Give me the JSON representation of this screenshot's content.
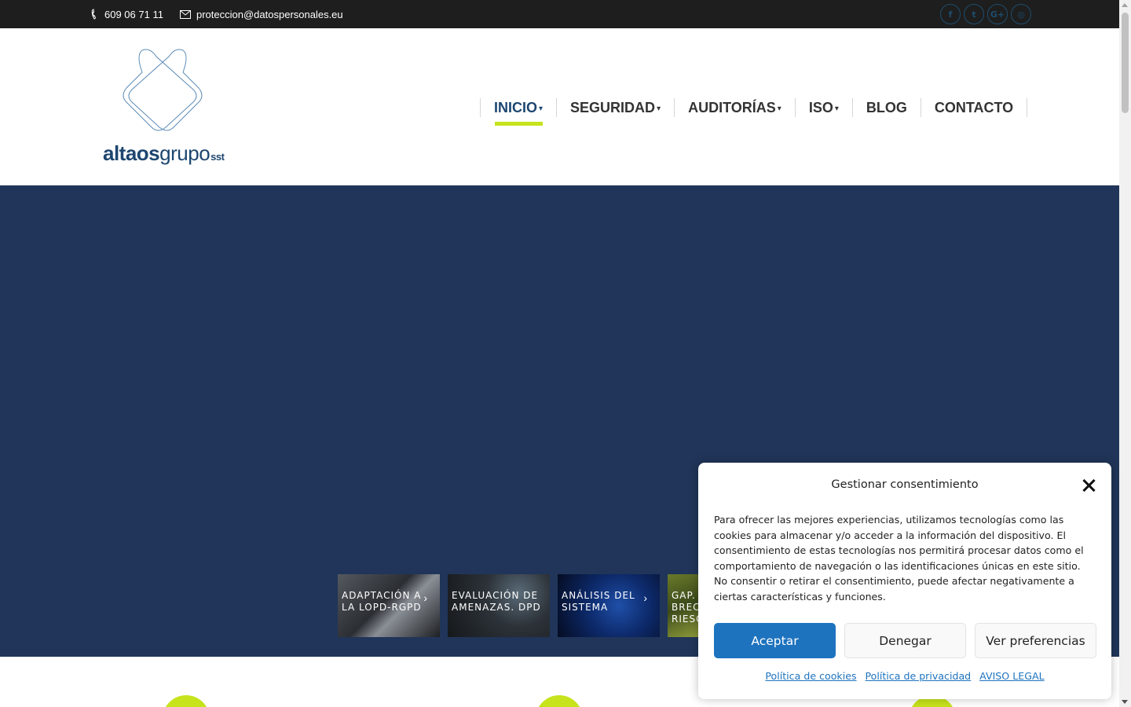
{
  "topbar": {
    "phone": "609 06 71 11",
    "email": "proteccion@datospersonales.eu",
    "socials": [
      {
        "icon": "facebook-icon",
        "glyph": "f"
      },
      {
        "icon": "twitter-icon",
        "glyph": "t"
      },
      {
        "icon": "google-plus-icon",
        "glyph": "G+"
      },
      {
        "icon": "dribbble-icon",
        "glyph": "◎"
      }
    ]
  },
  "logo": {
    "bold": "altaos",
    "regular": "grupo",
    "suffix": "sst"
  },
  "nav": {
    "items": [
      {
        "label": "INICIO",
        "dropdown": true,
        "active": true
      },
      {
        "label": "SEGURIDAD",
        "dropdown": true,
        "active": false
      },
      {
        "label": "AUDITORÍAS",
        "dropdown": true,
        "active": false
      },
      {
        "label": "ISO",
        "dropdown": true,
        "active": false
      },
      {
        "label": "BLOG",
        "dropdown": false,
        "active": false
      },
      {
        "label": "CONTACTO",
        "dropdown": false,
        "active": false
      }
    ]
  },
  "hero": {
    "thumbnails": [
      {
        "label": "ADAPTACIÓN A LA LOPD-RGPD"
      },
      {
        "label": "EVALUACIÓN DE AMENAZAS. DPD"
      },
      {
        "label": "ANÁLISIS DEL SISTEMA"
      },
      {
        "label": "GAP. BREC. RIESG"
      }
    ]
  },
  "cookie": {
    "title": "Gestionar consentimiento",
    "body": "Para ofrecer las mejores experiencias, utilizamos tecnologías como las cookies para almacenar y/o acceder a la información del dispositivo. El consentimiento de estas tecnologías nos permitirá procesar datos como el comportamiento de navegación o las identificaciones únicas en este sitio. No consentir o retirar el consentimiento, puede afectar negativamente a ciertas características y funciones.",
    "accept": "Aceptar",
    "deny": "Denegar",
    "preferences": "Ver preferencias",
    "links": {
      "cookies": "Política de cookies",
      "privacy": "Política de privacidad",
      "legal": "AVISO LEGAL"
    }
  },
  "colors": {
    "topbar": "#1e1e1e",
    "brand": "#1d4670",
    "accent": "#c6e31c",
    "hero": "#203559",
    "button": "#1e73be"
  }
}
